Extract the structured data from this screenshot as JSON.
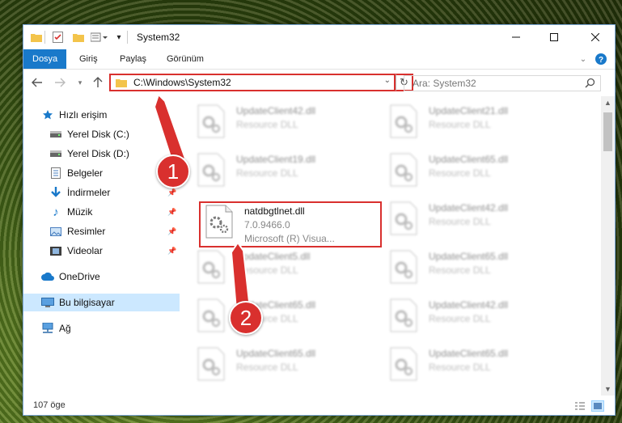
{
  "window": {
    "title": "System32"
  },
  "ribbon": {
    "tabs": [
      {
        "label": "Dosya",
        "active": true
      },
      {
        "label": "Giriş"
      },
      {
        "label": "Paylaş"
      },
      {
        "label": "Görünüm"
      }
    ]
  },
  "nav": {
    "address_path": "C:\\Windows\\System32",
    "search_placeholder": "Ara: System32"
  },
  "sidebar": {
    "items": [
      {
        "label": "Hızlı erişim",
        "icon": "star-icon"
      },
      {
        "label": "Yerel Disk (C:)",
        "icon": "drive-icon",
        "pinned": true
      },
      {
        "label": "Yerel Disk (D:)",
        "icon": "drive-icon",
        "pinned": true
      },
      {
        "label": "Belgeler",
        "icon": "document-icon",
        "pinned": true
      },
      {
        "label": "İndirmeler",
        "icon": "download-icon",
        "pinned": true
      },
      {
        "label": "Müzik",
        "icon": "music-icon",
        "pinned": true
      },
      {
        "label": "Resimler",
        "icon": "pictures-icon",
        "pinned": true
      },
      {
        "label": "Videolar",
        "icon": "video-icon",
        "pinned": true
      },
      {
        "label": "OneDrive",
        "icon": "cloud-icon"
      },
      {
        "label": "Bu bilgisayar",
        "icon": "computer-icon",
        "selected": true
      },
      {
        "label": "Ağ",
        "icon": "network-icon"
      }
    ]
  },
  "files": [
    {
      "name": "UpdateClient42.dll",
      "type": "Resource DLL"
    },
    {
      "name": "UpdateClient21.dll",
      "type": "Resource DLL"
    },
    {
      "name": "UpdateClient19.dll",
      "type": "Resource DLL"
    },
    {
      "name": "UpdateClient65.dll",
      "type": "Resource DLL"
    },
    {
      "name": "natdbgtlnet.dll",
      "version": "7.0.9466.0",
      "company": "Microsoft (R) Visua...",
      "highlighted": true
    },
    {
      "name": "UpdateClient42.dll",
      "type": "Resource DLL"
    },
    {
      "name": "UpdateClient5.dll",
      "type": "Resource DLL"
    },
    {
      "name": "UpdateClient65.dll",
      "type": "Resource DLL"
    },
    {
      "name": "UpdateClient65.dll",
      "type": "Resource DLL"
    },
    {
      "name": "UpdateClient42.dll",
      "type": "Resource DLL"
    },
    {
      "name": "UpdateClient65.dll",
      "type": "Resource DLL"
    },
    {
      "name": "UpdateClient65.dll",
      "type": "Resource DLL"
    }
  ],
  "status": {
    "count": "107 öge"
  },
  "annotations": {
    "step1": "1",
    "step2": "2"
  },
  "colors": {
    "accent": "#1979ca",
    "highlight": "#d9302e",
    "selection": "#cce8ff"
  }
}
